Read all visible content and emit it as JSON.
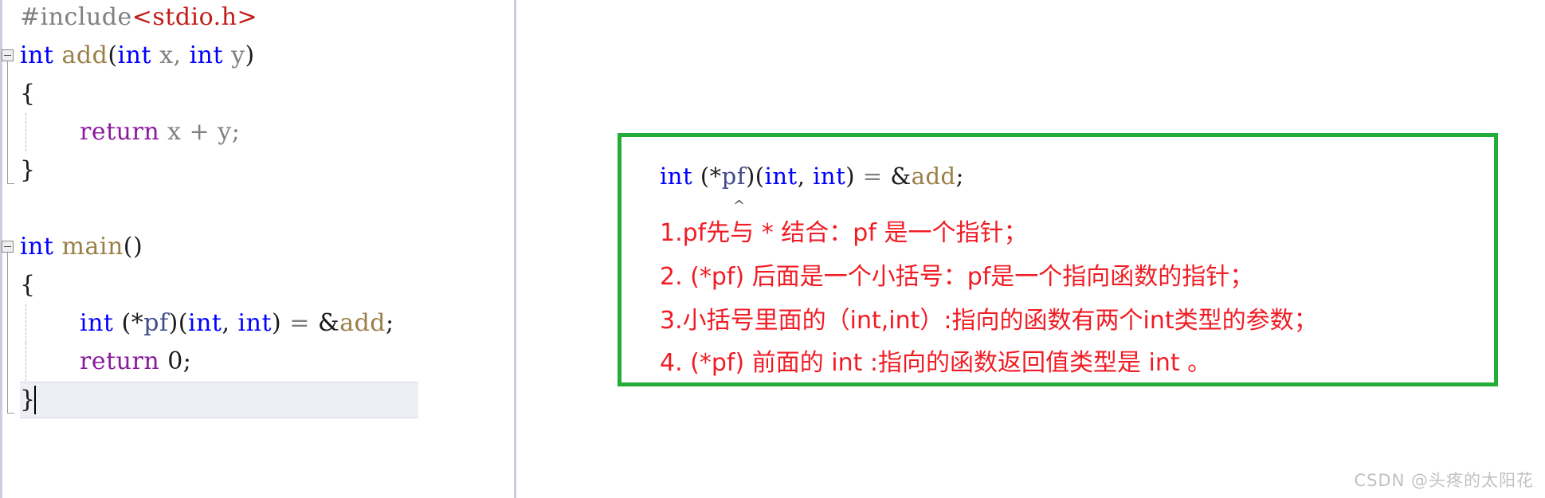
{
  "editor": {
    "lines": [
      {
        "indent": 0,
        "segments": [
          {
            "text": "#include",
            "cls": "tok-pre"
          },
          {
            "text": "<stdio.h>",
            "cls": "tok-str"
          }
        ]
      },
      {
        "indent": 0,
        "fold": "start",
        "segments": [
          {
            "text": "int",
            "cls": "tok-kw"
          },
          {
            "text": " ",
            "cls": "tok-plain"
          },
          {
            "text": "add",
            "cls": "tok-fn"
          },
          {
            "text": "(",
            "cls": "tok-punct"
          },
          {
            "text": "int",
            "cls": "tok-kw"
          },
          {
            "text": " x, ",
            "cls": "tok-plain"
          },
          {
            "text": "int",
            "cls": "tok-kw"
          },
          {
            "text": " y",
            "cls": "tok-plain"
          },
          {
            "text": ")",
            "cls": "tok-punct"
          }
        ]
      },
      {
        "indent": 0,
        "segments": [
          {
            "text": "{",
            "cls": "tok-punct"
          }
        ]
      },
      {
        "indent": 1,
        "segments": [
          {
            "text": "return",
            "cls": "tok-ret"
          },
          {
            "text": " x + y;",
            "cls": "tok-plain"
          }
        ]
      },
      {
        "indent": 0,
        "fold": "end",
        "segments": [
          {
            "text": "}",
            "cls": "tok-punct"
          }
        ]
      },
      {
        "indent": 0,
        "segments": []
      },
      {
        "indent": 0,
        "fold": "start",
        "segments": [
          {
            "text": "int",
            "cls": "tok-kw"
          },
          {
            "text": " ",
            "cls": "tok-plain"
          },
          {
            "text": "main",
            "cls": "tok-fn"
          },
          {
            "text": "()",
            "cls": "tok-punct"
          }
        ]
      },
      {
        "indent": 0,
        "segments": [
          {
            "text": "{",
            "cls": "tok-punct"
          }
        ]
      },
      {
        "indent": 1,
        "segments": [
          {
            "text": "int",
            "cls": "tok-kw"
          },
          {
            "text": " ",
            "cls": "tok-plain"
          },
          {
            "text": "(",
            "cls": "tok-punct"
          },
          {
            "text": "*",
            "cls": "tok-punct"
          },
          {
            "text": "pf",
            "cls": "tok-var"
          },
          {
            "text": ")(",
            "cls": "tok-punct"
          },
          {
            "text": "int",
            "cls": "tok-kw"
          },
          {
            "text": ", ",
            "cls": "tok-punct"
          },
          {
            "text": "int",
            "cls": "tok-kw"
          },
          {
            "text": ")",
            "cls": "tok-punct"
          },
          {
            "text": " = ",
            "cls": "tok-plain"
          },
          {
            "text": "&",
            "cls": "tok-punct"
          },
          {
            "text": "add",
            "cls": "tok-fn"
          },
          {
            "text": ";",
            "cls": "tok-punct"
          }
        ]
      },
      {
        "indent": 1,
        "segments": [
          {
            "text": "return",
            "cls": "tok-ret"
          },
          {
            "text": " ",
            "cls": "tok-plain"
          },
          {
            "text": "0",
            "cls": "tok-num"
          },
          {
            "text": ";",
            "cls": "tok-punct"
          }
        ]
      },
      {
        "indent": 0,
        "fold": "end",
        "current": true,
        "segments": [
          {
            "text": "}",
            "cls": "tok-punct"
          }
        ]
      }
    ],
    "plain_source": "#include<stdio.h>\nint add(int x, int y)\n{\n    return x + y;\n}\n\nint main()\n{\n    int (*pf)(int, int) = &add;\n    return 0;\n}"
  },
  "note": {
    "code_segments": [
      {
        "text": "int",
        "cls": "tok-kw"
      },
      {
        "text": " ",
        "cls": "tok-plain"
      },
      {
        "text": "(",
        "cls": "tok-punct"
      },
      {
        "text": "*",
        "cls": "tok-punct"
      },
      {
        "text": "pf",
        "cls": "tok-var"
      },
      {
        "text": ")(",
        "cls": "tok-punct"
      },
      {
        "text": "int",
        "cls": "tok-kw"
      },
      {
        "text": ", ",
        "cls": "tok-punct"
      },
      {
        "text": "int",
        "cls": "tok-kw"
      },
      {
        "text": ")",
        "cls": "tok-punct"
      },
      {
        "text": " = ",
        "cls": "tok-plain"
      },
      {
        "text": "&",
        "cls": "tok-punct"
      },
      {
        "text": "add",
        "cls": "tok-fn"
      },
      {
        "text": ";",
        "cls": "tok-punct"
      }
    ],
    "code_plain": "int (*pf)(int, int) = &add;",
    "caret_dot": "^",
    "lines": [
      "1.pf先与 * 结合：pf 是一个指针；",
      "2. (*pf) 后面是一个小括号：pf是一个指向函数的指针；",
      "3.小括号里面的（int,int）:指向的函数有两个int类型的参数；",
      "4. (*pf) 前面的 int :指向的函数返回值类型是 int 。"
    ],
    "border_color": "#22ac38",
    "text_color": "#f01c24"
  },
  "watermark": {
    "text": "CSDN @头疼的太阳花"
  }
}
